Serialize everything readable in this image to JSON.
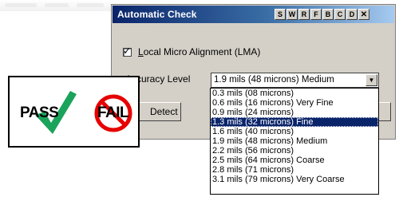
{
  "dialog": {
    "title": "Automatic Check",
    "titlebar_buttons": [
      "S",
      "W",
      "R",
      "F",
      "B",
      "C",
      "D"
    ],
    "close_glyph": "✕",
    "checkbox": {
      "checked": true,
      "check_glyph": "✓",
      "label_prefix": "L",
      "label_rest": "ocal Micro Alignment (LMA)"
    },
    "accuracy_label": "Accuracy Level",
    "select_value": "1.9 mils (48 microns) Medium",
    "select_arrow": "▼",
    "detect_label": "Detect"
  },
  "dropdown": {
    "options": [
      "0.3 mils (08 microns)",
      "0.6 mils (16 microns) Very Fine",
      "0.9 mils (24 microns)",
      "1.3 mils (32 microns) Fine",
      "1.6 mils (40 microns)",
      "1.9 mils (48 microns) Medium",
      "2.2 mils (56 microns)",
      "2.5 mils (64 microns) Coarse",
      "2.8 mils (71 microns)",
      "3.1 mils (79 microns) Very Coarse"
    ],
    "selected_index": 3
  },
  "pass_fail": {
    "pass_text": "PASS",
    "fail_text": "FAIL",
    "check_color": "#1aa35a",
    "no_sign_color": "#e60000"
  },
  "colors": {
    "titlebar_start": "#0a246a",
    "titlebar_end": "#a6caf0",
    "dialog_face": "#d4d0c8",
    "selection": "#0a246a"
  }
}
